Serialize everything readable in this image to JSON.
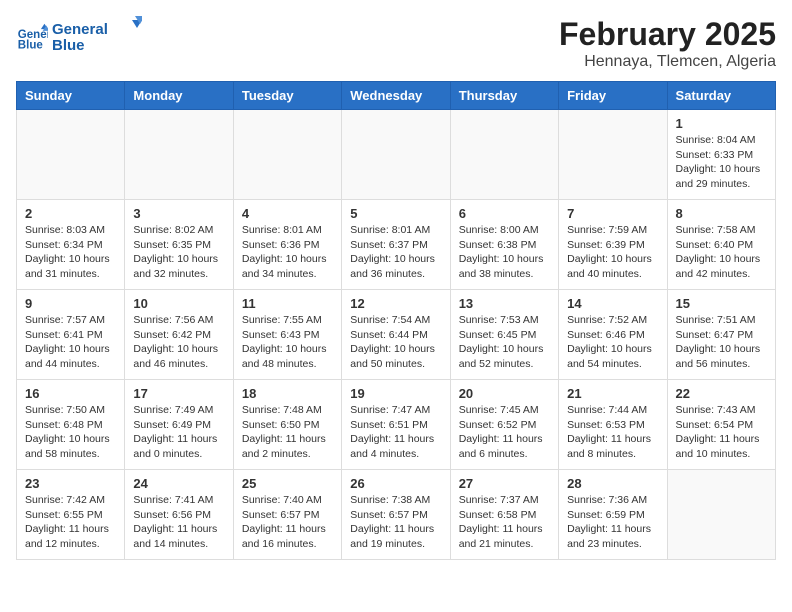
{
  "logo": {
    "line1": "General",
    "line2": "Blue"
  },
  "title": "February 2025",
  "location": "Hennaya, Tlemcen, Algeria",
  "days_of_week": [
    "Sunday",
    "Monday",
    "Tuesday",
    "Wednesday",
    "Thursday",
    "Friday",
    "Saturday"
  ],
  "weeks": [
    [
      {
        "day": "",
        "info": ""
      },
      {
        "day": "",
        "info": ""
      },
      {
        "day": "",
        "info": ""
      },
      {
        "day": "",
        "info": ""
      },
      {
        "day": "",
        "info": ""
      },
      {
        "day": "",
        "info": ""
      },
      {
        "day": "1",
        "info": "Sunrise: 8:04 AM\nSunset: 6:33 PM\nDaylight: 10 hours and 29 minutes."
      }
    ],
    [
      {
        "day": "2",
        "info": "Sunrise: 8:03 AM\nSunset: 6:34 PM\nDaylight: 10 hours and 31 minutes."
      },
      {
        "day": "3",
        "info": "Sunrise: 8:02 AM\nSunset: 6:35 PM\nDaylight: 10 hours and 32 minutes."
      },
      {
        "day": "4",
        "info": "Sunrise: 8:01 AM\nSunset: 6:36 PM\nDaylight: 10 hours and 34 minutes."
      },
      {
        "day": "5",
        "info": "Sunrise: 8:01 AM\nSunset: 6:37 PM\nDaylight: 10 hours and 36 minutes."
      },
      {
        "day": "6",
        "info": "Sunrise: 8:00 AM\nSunset: 6:38 PM\nDaylight: 10 hours and 38 minutes."
      },
      {
        "day": "7",
        "info": "Sunrise: 7:59 AM\nSunset: 6:39 PM\nDaylight: 10 hours and 40 minutes."
      },
      {
        "day": "8",
        "info": "Sunrise: 7:58 AM\nSunset: 6:40 PM\nDaylight: 10 hours and 42 minutes."
      }
    ],
    [
      {
        "day": "9",
        "info": "Sunrise: 7:57 AM\nSunset: 6:41 PM\nDaylight: 10 hours and 44 minutes."
      },
      {
        "day": "10",
        "info": "Sunrise: 7:56 AM\nSunset: 6:42 PM\nDaylight: 10 hours and 46 minutes."
      },
      {
        "day": "11",
        "info": "Sunrise: 7:55 AM\nSunset: 6:43 PM\nDaylight: 10 hours and 48 minutes."
      },
      {
        "day": "12",
        "info": "Sunrise: 7:54 AM\nSunset: 6:44 PM\nDaylight: 10 hours and 50 minutes."
      },
      {
        "day": "13",
        "info": "Sunrise: 7:53 AM\nSunset: 6:45 PM\nDaylight: 10 hours and 52 minutes."
      },
      {
        "day": "14",
        "info": "Sunrise: 7:52 AM\nSunset: 6:46 PM\nDaylight: 10 hours and 54 minutes."
      },
      {
        "day": "15",
        "info": "Sunrise: 7:51 AM\nSunset: 6:47 PM\nDaylight: 10 hours and 56 minutes."
      }
    ],
    [
      {
        "day": "16",
        "info": "Sunrise: 7:50 AM\nSunset: 6:48 PM\nDaylight: 10 hours and 58 minutes."
      },
      {
        "day": "17",
        "info": "Sunrise: 7:49 AM\nSunset: 6:49 PM\nDaylight: 11 hours and 0 minutes."
      },
      {
        "day": "18",
        "info": "Sunrise: 7:48 AM\nSunset: 6:50 PM\nDaylight: 11 hours and 2 minutes."
      },
      {
        "day": "19",
        "info": "Sunrise: 7:47 AM\nSunset: 6:51 PM\nDaylight: 11 hours and 4 minutes."
      },
      {
        "day": "20",
        "info": "Sunrise: 7:45 AM\nSunset: 6:52 PM\nDaylight: 11 hours and 6 minutes."
      },
      {
        "day": "21",
        "info": "Sunrise: 7:44 AM\nSunset: 6:53 PM\nDaylight: 11 hours and 8 minutes."
      },
      {
        "day": "22",
        "info": "Sunrise: 7:43 AM\nSunset: 6:54 PM\nDaylight: 11 hours and 10 minutes."
      }
    ],
    [
      {
        "day": "23",
        "info": "Sunrise: 7:42 AM\nSunset: 6:55 PM\nDaylight: 11 hours and 12 minutes."
      },
      {
        "day": "24",
        "info": "Sunrise: 7:41 AM\nSunset: 6:56 PM\nDaylight: 11 hours and 14 minutes."
      },
      {
        "day": "25",
        "info": "Sunrise: 7:40 AM\nSunset: 6:57 PM\nDaylight: 11 hours and 16 minutes."
      },
      {
        "day": "26",
        "info": "Sunrise: 7:38 AM\nSunset: 6:57 PM\nDaylight: 11 hours and 19 minutes."
      },
      {
        "day": "27",
        "info": "Sunrise: 7:37 AM\nSunset: 6:58 PM\nDaylight: 11 hours and 21 minutes."
      },
      {
        "day": "28",
        "info": "Sunrise: 7:36 AM\nSunset: 6:59 PM\nDaylight: 11 hours and 23 minutes."
      },
      {
        "day": "",
        "info": ""
      }
    ]
  ]
}
